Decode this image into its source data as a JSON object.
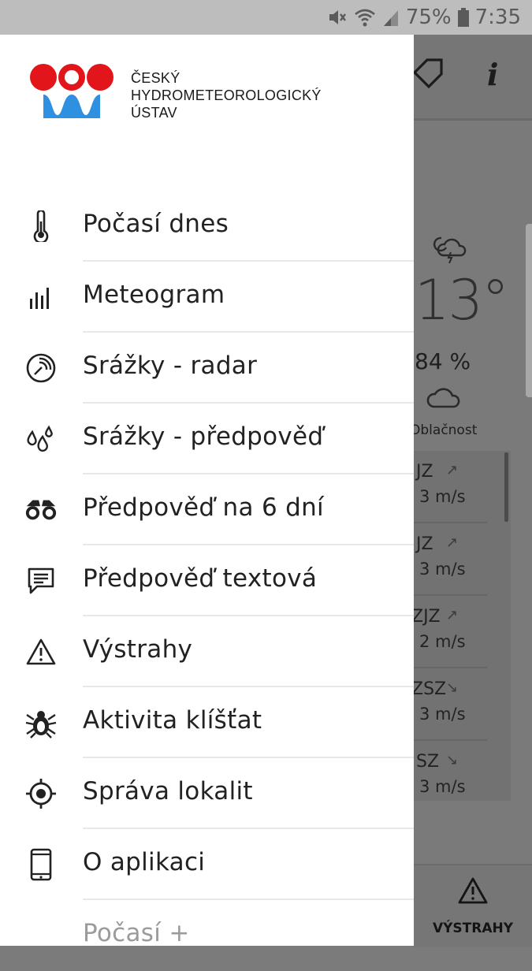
{
  "status_bar": {
    "battery": "75%",
    "time": "7:35"
  },
  "background_app": {
    "temperature": "13°",
    "humidity": "84 %",
    "cloud_label": "Oblačnost",
    "wind": [
      {
        "dir": "JZ",
        "arrow": "↗",
        "speed": "3 m/s"
      },
      {
        "dir": "JZ",
        "arrow": "↗",
        "speed": "3 m/s"
      },
      {
        "dir": "ZJZ",
        "arrow": "↗",
        "speed": "2 m/s"
      },
      {
        "dir": "ZSZ",
        "arrow": "↘",
        "speed": "3 m/s"
      },
      {
        "dir": "SZ",
        "arrow": "↘",
        "speed": "3 m/s"
      }
    ],
    "warnings_label": "VÝSTRAHY",
    "info_glyph": "i"
  },
  "drawer": {
    "org_name": [
      "ČESKÝ",
      "HYDROMETEOROLOGICKÝ",
      "ÚSTAV"
    ],
    "menu": [
      {
        "label": "Počasí dnes",
        "icon": "thermometer-icon"
      },
      {
        "label": "Meteogram",
        "icon": "bar-chart-icon"
      },
      {
        "label": "Srážky - radar",
        "icon": "radar-icon"
      },
      {
        "label": "Srážky - předpověď",
        "icon": "drops-icon"
      },
      {
        "label": "Předpověď na 6 dní",
        "icon": "binoculars-icon"
      },
      {
        "label": "Předpověď textová",
        "icon": "message-icon"
      },
      {
        "label": "Výstrahy",
        "icon": "warning-icon"
      },
      {
        "label": "Aktivita klíšťat",
        "icon": "tick-icon"
      },
      {
        "label": "Správa lokalit",
        "icon": "location-target-icon"
      },
      {
        "label": "O aplikaci",
        "icon": "phone-icon"
      },
      {
        "label": "Počasí +",
        "icon": ""
      }
    ]
  },
  "colors": {
    "brand_red": "#e2151a",
    "brand_blue": "#2f8fe0"
  }
}
